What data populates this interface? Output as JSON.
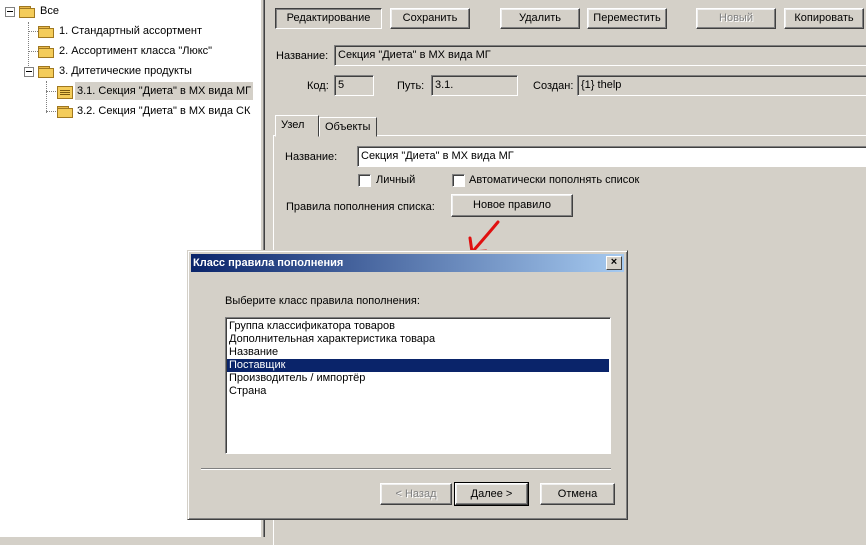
{
  "tree": {
    "root": "Все",
    "items": [
      "1. Стандартный ассортмент",
      "2. Ассортимент класса \"Люкс\"",
      "3. Дитетические продукты",
      "3.1. Секция \"Диета\" в МХ вида МГ",
      "3.2. Секция \"Диета\" в МХ вида СК"
    ]
  },
  "toolbar": {
    "edit": "Редактирование",
    "save": "Сохранить",
    "delete": "Удалить",
    "move": "Переместить",
    "new": "Новый",
    "copy": "Копировать"
  },
  "header": {
    "name_label": "Название:",
    "name_value": "Секция \"Диета\" в МХ вида МГ",
    "code_label": "Код:",
    "code_value": "5",
    "path_label": "Путь:",
    "path_value": "3.1.",
    "created_label": "Создан:",
    "created_value": "{1} thelp"
  },
  "tabs": [
    "Узел",
    "Объекты"
  ],
  "node": {
    "name_label": "Название:",
    "name_value": "Секция \"Диета\" в МХ вида МГ",
    "personal_label": "Личный",
    "autofill_label": "Автоматически пополнять список",
    "rules_label": "Правила пополнения списка:",
    "new_rule": "Новое правило"
  },
  "dialog": {
    "title": "Класс правила пополнения",
    "close": "×",
    "prompt": "Выберите класс правила пополнения:",
    "options": [
      "Группа классификатора товаров",
      "Дополнительная характеристика товара",
      "Название",
      "Поставщик",
      "Производитель / импортёр",
      "Страна"
    ],
    "selected_index": 3,
    "back": "< Назад",
    "next": "Далее >",
    "cancel": "Отмена"
  },
  "colors": {
    "selection": "#0a246a",
    "annotation_arrow": "#e01010"
  }
}
